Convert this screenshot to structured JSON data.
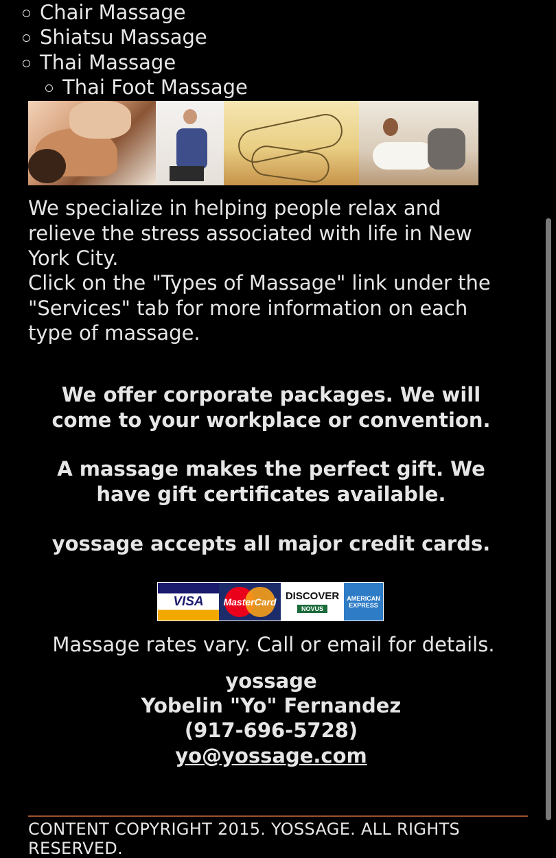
{
  "services_list": {
    "items": [
      "Chair Massage",
      "Shiatsu Massage",
      "Thai Massage"
    ],
    "subitems": [
      "Thai Foot Massage"
    ]
  },
  "photos": [
    "back-massage-photo",
    "chair-massage-photo",
    "shiatsu-illustration",
    "thai-massage-photo"
  ],
  "intro": {
    "line1": "We specialize in helping people relax and relieve the stress associated with life in New York City.",
    "line2": "Click on the \"Types of Massage\" link under the \"Services\" tab for more information on each type of massage."
  },
  "offers": {
    "corporate": "We offer corporate packages. We will come to your workplace or convention.",
    "gift": "A massage makes the perfect gift. We have gift certificates available.",
    "cards": "yossage accepts all major credit cards."
  },
  "credit_cards": {
    "visa": "VISA",
    "mastercard": "MasterCard",
    "discover": "DISCOVER",
    "discover_sub": "NOVUS",
    "amex": "AMERICAN EXPRESS"
  },
  "rates": "Massage rates vary. Call or email for details.",
  "contact": {
    "business": "yossage",
    "name": "Yobelin \"Yo\" Fernandez",
    "phone": "(917-696-5728)",
    "email": "yo@yossage.com"
  },
  "footer": {
    "copyright": "CONTENT COPYRIGHT 2015. YOSSAGE. ALL RIGHTS RESERVED."
  },
  "colors": {
    "background": "#000000",
    "text": "#e6e6e6",
    "rule": "#a0522d"
  }
}
